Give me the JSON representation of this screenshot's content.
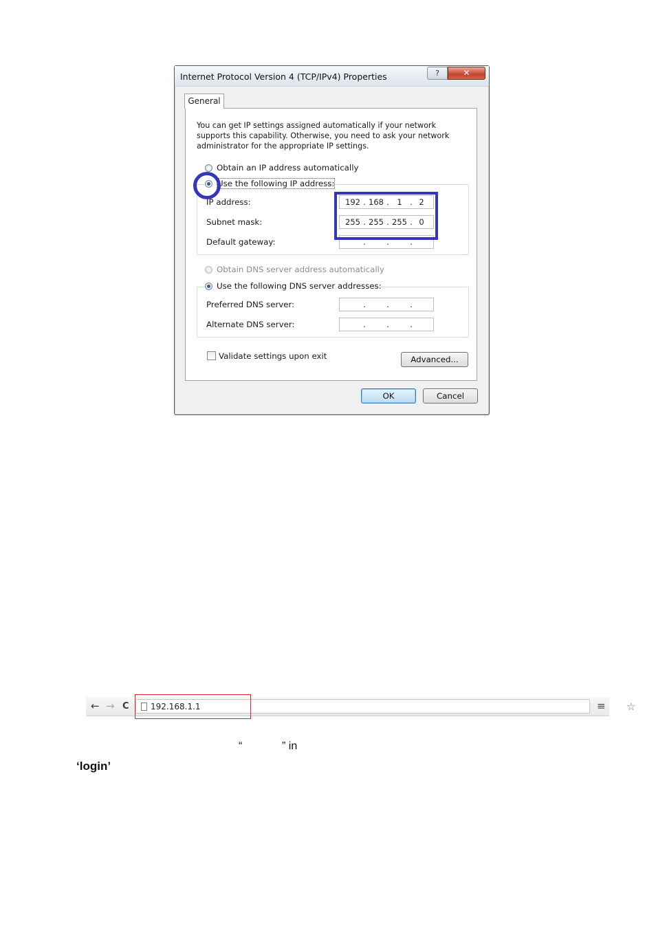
{
  "dialog": {
    "title": "Internet Protocol Version 4 (TCP/IPv4) Properties",
    "help_symbol": "?",
    "close_symbol": "✕",
    "tab_general": "General",
    "intro": "You can get IP settings assigned automatically if your network supports this capability. Otherwise, you need to ask your network administrator for the appropriate IP settings.",
    "radio_obtain_ip": "Obtain an IP address automatically",
    "radio_use_ip": "Use the following IP address:",
    "ip_label": "IP address:",
    "ip_address": [
      "192",
      "168",
      "1",
      "2"
    ],
    "subnet_label": "Subnet mask:",
    "subnet_mask": [
      "255",
      "255",
      "255",
      "0"
    ],
    "gateway_label": "Default gateway:",
    "radio_obtain_dns": "Obtain DNS server address automatically",
    "radio_use_dns": "Use the following DNS server addresses:",
    "preferred_dns_label": "Preferred DNS server:",
    "alternate_dns_label": "Alternate DNS server:",
    "validate_label": "Validate settings upon exit",
    "advanced_button": "Advanced...",
    "ok_button": "OK",
    "cancel_button": "Cancel",
    "dot": "."
  },
  "browser": {
    "back_icon": "←",
    "forward_icon": "→",
    "reload_icon": "C",
    "url": "192.168.1.1",
    "star_icon": "☆",
    "menu_icon": "≡"
  },
  "captions": {
    "quote_open": "“",
    "quote_close_in": "” in",
    "login": "‘login’"
  },
  "colors": {
    "annotation_blue": "#3437b8",
    "annotation_red": "#d9272e"
  }
}
